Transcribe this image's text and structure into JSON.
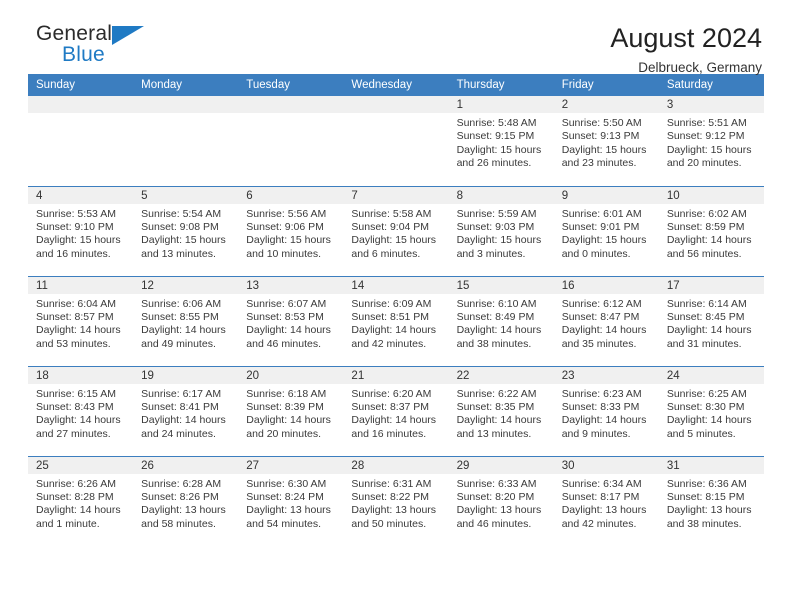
{
  "branding": {
    "name_top": "General",
    "name_bottom": "Blue",
    "accent_color": "#1f7ac4"
  },
  "header": {
    "title": "August 2024",
    "subtitle": "Delbrueck, Germany"
  },
  "theme": {
    "header_row_bg": "#3c7ebf",
    "daynum_bg": "#f0f0f0",
    "grid_line": "#3c7ebf"
  },
  "labels": {
    "sunrise_prefix": "Sunrise:",
    "sunset_prefix": "Sunset:",
    "daylight_prefix": "Daylight:"
  },
  "weekday_headers": [
    "Sunday",
    "Monday",
    "Tuesday",
    "Wednesday",
    "Thursday",
    "Friday",
    "Saturday"
  ],
  "weeks": [
    [
      {
        "day": "",
        "sunrise": "",
        "sunset": "",
        "daylight_line1": "",
        "daylight_line2": ""
      },
      {
        "day": "",
        "sunrise": "",
        "sunset": "",
        "daylight_line1": "",
        "daylight_line2": ""
      },
      {
        "day": "",
        "sunrise": "",
        "sunset": "",
        "daylight_line1": "",
        "daylight_line2": ""
      },
      {
        "day": "",
        "sunrise": "",
        "sunset": "",
        "daylight_line1": "",
        "daylight_line2": ""
      },
      {
        "day": "1",
        "sunrise": "Sunrise: 5:48 AM",
        "sunset": "Sunset: 9:15 PM",
        "daylight_line1": "Daylight: 15 hours",
        "daylight_line2": "and 26 minutes."
      },
      {
        "day": "2",
        "sunrise": "Sunrise: 5:50 AM",
        "sunset": "Sunset: 9:13 PM",
        "daylight_line1": "Daylight: 15 hours",
        "daylight_line2": "and 23 minutes."
      },
      {
        "day": "3",
        "sunrise": "Sunrise: 5:51 AM",
        "sunset": "Sunset: 9:12 PM",
        "daylight_line1": "Daylight: 15 hours",
        "daylight_line2": "and 20 minutes."
      }
    ],
    [
      {
        "day": "4",
        "sunrise": "Sunrise: 5:53 AM",
        "sunset": "Sunset: 9:10 PM",
        "daylight_line1": "Daylight: 15 hours",
        "daylight_line2": "and 16 minutes."
      },
      {
        "day": "5",
        "sunrise": "Sunrise: 5:54 AM",
        "sunset": "Sunset: 9:08 PM",
        "daylight_line1": "Daylight: 15 hours",
        "daylight_line2": "and 13 minutes."
      },
      {
        "day": "6",
        "sunrise": "Sunrise: 5:56 AM",
        "sunset": "Sunset: 9:06 PM",
        "daylight_line1": "Daylight: 15 hours",
        "daylight_line2": "and 10 minutes."
      },
      {
        "day": "7",
        "sunrise": "Sunrise: 5:58 AM",
        "sunset": "Sunset: 9:04 PM",
        "daylight_line1": "Daylight: 15 hours",
        "daylight_line2": "and 6 minutes."
      },
      {
        "day": "8",
        "sunrise": "Sunrise: 5:59 AM",
        "sunset": "Sunset: 9:03 PM",
        "daylight_line1": "Daylight: 15 hours",
        "daylight_line2": "and 3 minutes."
      },
      {
        "day": "9",
        "sunrise": "Sunrise: 6:01 AM",
        "sunset": "Sunset: 9:01 PM",
        "daylight_line1": "Daylight: 15 hours",
        "daylight_line2": "and 0 minutes."
      },
      {
        "day": "10",
        "sunrise": "Sunrise: 6:02 AM",
        "sunset": "Sunset: 8:59 PM",
        "daylight_line1": "Daylight: 14 hours",
        "daylight_line2": "and 56 minutes."
      }
    ],
    [
      {
        "day": "11",
        "sunrise": "Sunrise: 6:04 AM",
        "sunset": "Sunset: 8:57 PM",
        "daylight_line1": "Daylight: 14 hours",
        "daylight_line2": "and 53 minutes."
      },
      {
        "day": "12",
        "sunrise": "Sunrise: 6:06 AM",
        "sunset": "Sunset: 8:55 PM",
        "daylight_line1": "Daylight: 14 hours",
        "daylight_line2": "and 49 minutes."
      },
      {
        "day": "13",
        "sunrise": "Sunrise: 6:07 AM",
        "sunset": "Sunset: 8:53 PM",
        "daylight_line1": "Daylight: 14 hours",
        "daylight_line2": "and 46 minutes."
      },
      {
        "day": "14",
        "sunrise": "Sunrise: 6:09 AM",
        "sunset": "Sunset: 8:51 PM",
        "daylight_line1": "Daylight: 14 hours",
        "daylight_line2": "and 42 minutes."
      },
      {
        "day": "15",
        "sunrise": "Sunrise: 6:10 AM",
        "sunset": "Sunset: 8:49 PM",
        "daylight_line1": "Daylight: 14 hours",
        "daylight_line2": "and 38 minutes."
      },
      {
        "day": "16",
        "sunrise": "Sunrise: 6:12 AM",
        "sunset": "Sunset: 8:47 PM",
        "daylight_line1": "Daylight: 14 hours",
        "daylight_line2": "and 35 minutes."
      },
      {
        "day": "17",
        "sunrise": "Sunrise: 6:14 AM",
        "sunset": "Sunset: 8:45 PM",
        "daylight_line1": "Daylight: 14 hours",
        "daylight_line2": "and 31 minutes."
      }
    ],
    [
      {
        "day": "18",
        "sunrise": "Sunrise: 6:15 AM",
        "sunset": "Sunset: 8:43 PM",
        "daylight_line1": "Daylight: 14 hours",
        "daylight_line2": "and 27 minutes."
      },
      {
        "day": "19",
        "sunrise": "Sunrise: 6:17 AM",
        "sunset": "Sunset: 8:41 PM",
        "daylight_line1": "Daylight: 14 hours",
        "daylight_line2": "and 24 minutes."
      },
      {
        "day": "20",
        "sunrise": "Sunrise: 6:18 AM",
        "sunset": "Sunset: 8:39 PM",
        "daylight_line1": "Daylight: 14 hours",
        "daylight_line2": "and 20 minutes."
      },
      {
        "day": "21",
        "sunrise": "Sunrise: 6:20 AM",
        "sunset": "Sunset: 8:37 PM",
        "daylight_line1": "Daylight: 14 hours",
        "daylight_line2": "and 16 minutes."
      },
      {
        "day": "22",
        "sunrise": "Sunrise: 6:22 AM",
        "sunset": "Sunset: 8:35 PM",
        "daylight_line1": "Daylight: 14 hours",
        "daylight_line2": "and 13 minutes."
      },
      {
        "day": "23",
        "sunrise": "Sunrise: 6:23 AM",
        "sunset": "Sunset: 8:33 PM",
        "daylight_line1": "Daylight: 14 hours",
        "daylight_line2": "and 9 minutes."
      },
      {
        "day": "24",
        "sunrise": "Sunrise: 6:25 AM",
        "sunset": "Sunset: 8:30 PM",
        "daylight_line1": "Daylight: 14 hours",
        "daylight_line2": "and 5 minutes."
      }
    ],
    [
      {
        "day": "25",
        "sunrise": "Sunrise: 6:26 AM",
        "sunset": "Sunset: 8:28 PM",
        "daylight_line1": "Daylight: 14 hours",
        "daylight_line2": "and 1 minute."
      },
      {
        "day": "26",
        "sunrise": "Sunrise: 6:28 AM",
        "sunset": "Sunset: 8:26 PM",
        "daylight_line1": "Daylight: 13 hours",
        "daylight_line2": "and 58 minutes."
      },
      {
        "day": "27",
        "sunrise": "Sunrise: 6:30 AM",
        "sunset": "Sunset: 8:24 PM",
        "daylight_line1": "Daylight: 13 hours",
        "daylight_line2": "and 54 minutes."
      },
      {
        "day": "28",
        "sunrise": "Sunrise: 6:31 AM",
        "sunset": "Sunset: 8:22 PM",
        "daylight_line1": "Daylight: 13 hours",
        "daylight_line2": "and 50 minutes."
      },
      {
        "day": "29",
        "sunrise": "Sunrise: 6:33 AM",
        "sunset": "Sunset: 8:20 PM",
        "daylight_line1": "Daylight: 13 hours",
        "daylight_line2": "and 46 minutes."
      },
      {
        "day": "30",
        "sunrise": "Sunrise: 6:34 AM",
        "sunset": "Sunset: 8:17 PM",
        "daylight_line1": "Daylight: 13 hours",
        "daylight_line2": "and 42 minutes."
      },
      {
        "day": "31",
        "sunrise": "Sunrise: 6:36 AM",
        "sunset": "Sunset: 8:15 PM",
        "daylight_line1": "Daylight: 13 hours",
        "daylight_line2": "and 38 minutes."
      }
    ]
  ]
}
